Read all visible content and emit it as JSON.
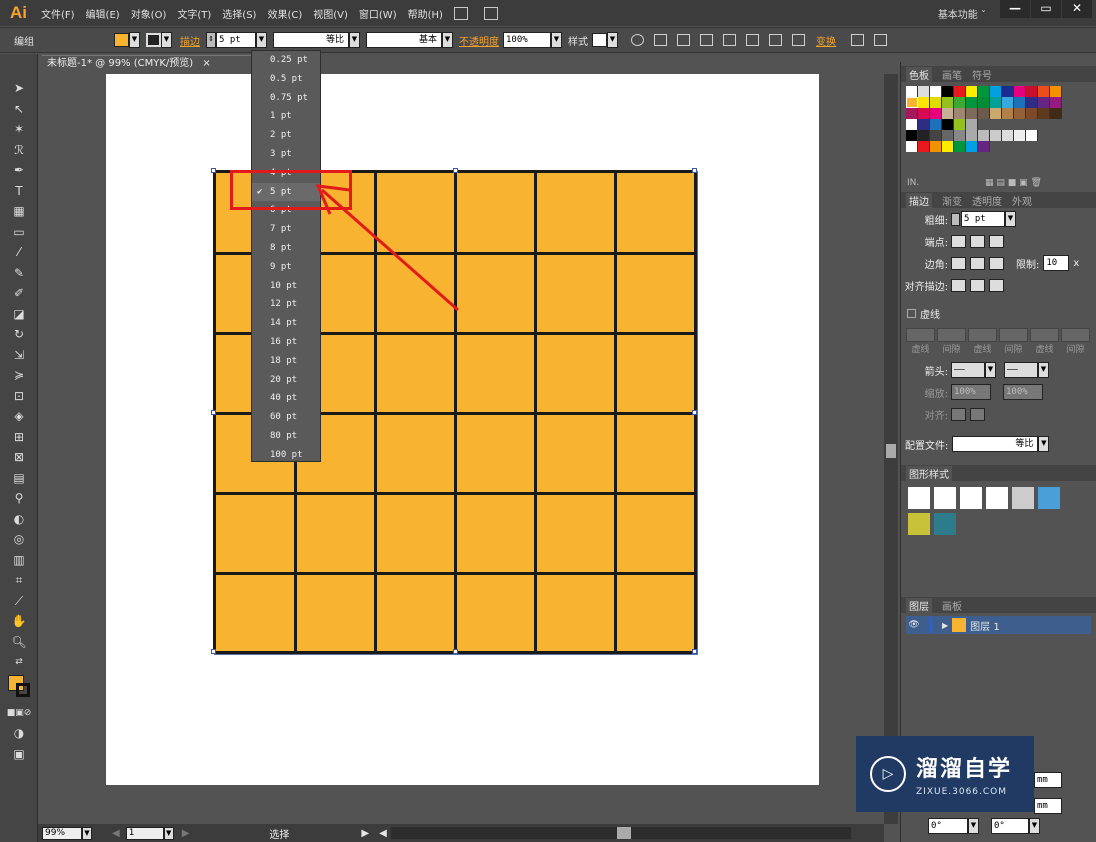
{
  "app": {
    "logo": "Ai",
    "workspace": "基本功能 ˇ"
  },
  "menu": [
    "文件(F)",
    "编辑(E)",
    "对象(O)",
    "文字(T)",
    "选择(S)",
    "效果(C)",
    "视图(V)",
    "窗口(W)",
    "帮助(H)"
  ],
  "window_buttons": [
    "—",
    "▭",
    "✕"
  ],
  "controlbar": {
    "mode": "编组",
    "stroke_label": "描边",
    "stroke_value": "5 pt",
    "profile": "等比",
    "brush": "基本",
    "opacity_label": "不透明度",
    "opacity_value": "100%",
    "style_label": "样式",
    "transform_label": "变换"
  },
  "document": {
    "tab_title": "未标题-1* @ 99% (CMYK/预览)",
    "close": "×"
  },
  "grid": {
    "rows": 6,
    "cols": 6,
    "fill_color": "#f8b330",
    "line_color": "#1a1a1a"
  },
  "stroke_dropdown": {
    "selected": "5 pt",
    "options": [
      "0.25 pt",
      "0.5 pt",
      "0.75 pt",
      "1 pt",
      "2 pt",
      "3 pt",
      "4 pt",
      "5 pt",
      "6 pt",
      "7 pt",
      "8 pt",
      "9 pt",
      "10 pt",
      "12 pt",
      "14 pt",
      "16 pt",
      "18 pt",
      "20 pt",
      "40 pt",
      "60 pt",
      "80 pt",
      "100 pt"
    ]
  },
  "swatches_panel": {
    "tabs": [
      "色板",
      "画笔",
      "符号"
    ]
  },
  "stroke_panel": {
    "tabs": [
      "描边",
      "渐变",
      "透明度",
      "外观"
    ],
    "weight_label": "粗细:",
    "weight_value": "5 pt",
    "cap_label": "端点:",
    "corner_label": "边角:",
    "limit_label": "限制:",
    "limit_value": "10",
    "limit_unit": "x",
    "align_label": "对齐描边:",
    "dashed_label": "虚线",
    "dash_labels": [
      "虚线",
      "间隙",
      "虚线",
      "间隙",
      "虚线",
      "间隙"
    ],
    "arrow_label": "箭头:",
    "scale_label": "缩放:",
    "scale_value1": "100%",
    "scale_value2": "100%",
    "align2_label": "对齐:",
    "profile_label": "配置文件:",
    "profile_value": "等比"
  },
  "graphic_styles_panel": {
    "tab": "图形样式"
  },
  "layers_panel": {
    "tabs": [
      "图层",
      "画板"
    ],
    "layer_name": "图层 1"
  },
  "statusbar": {
    "zoom": "99%",
    "page": "1",
    "tool": "选择"
  },
  "bottom_right": {
    "angle1": "0°",
    "angle2": "0°",
    "unit": "mm"
  },
  "watermark": {
    "title": "溜溜自学",
    "subtitle": "ZIXUE.3066.COM"
  },
  "colors": {
    "accent": "#f7a32e",
    "highlight": "#e21a1a",
    "grid_fill": "#f8b330"
  },
  "icons": [
    "selection-tool-icon",
    "pen-tool-icon",
    "type-tool-icon",
    "rectangle-tool-icon",
    "brush-tool-icon",
    "zoom-tool-icon",
    "hand-tool-icon",
    "eye-icon"
  ]
}
